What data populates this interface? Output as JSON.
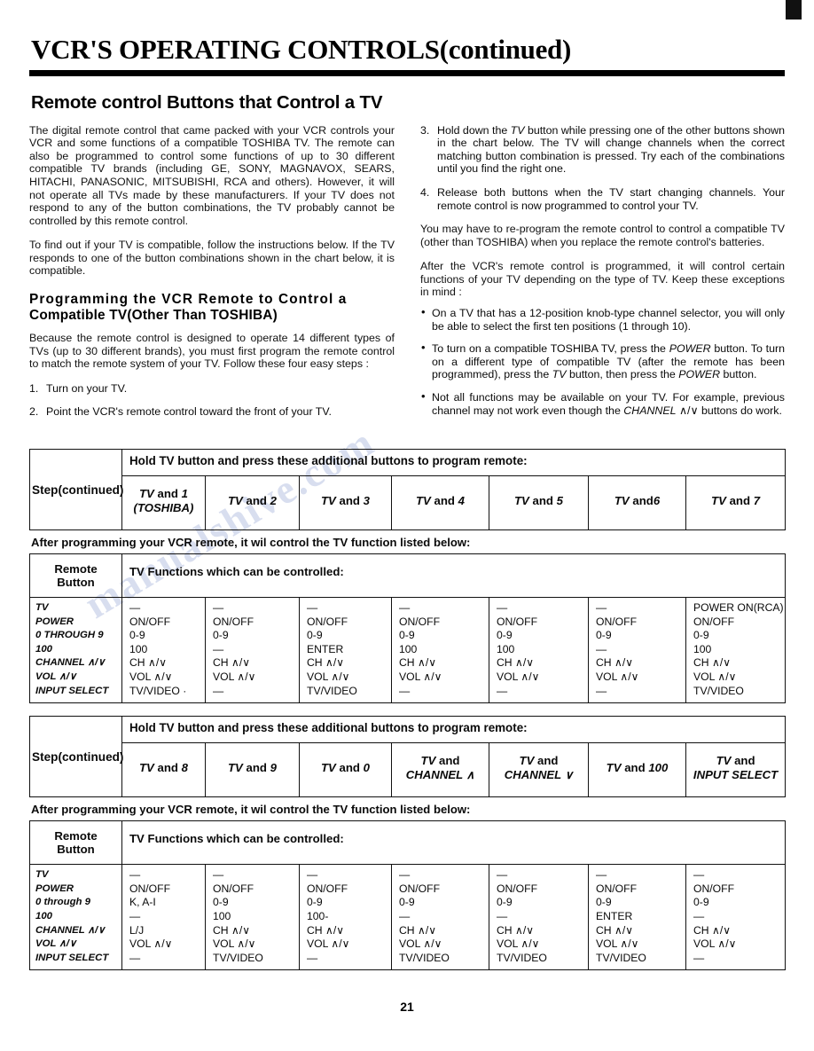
{
  "document": {
    "title": "VCR'S OPERATING CONTROLS(continued)",
    "section_title": "Remote control Buttons that Control a TV",
    "page_number": "21",
    "watermark": "manualshive.com"
  },
  "left_column": {
    "intro_p1": "The digital remote control that came packed with your VCR controls your VCR and some functions of a compatible TOSHIBA TV. The remote can also be programmed to control some functions of up to 30 different compatible TV brands (including GE, SONY, MAGNAVOX, SEARS, HITACHI, PANASONIC, MITSUBISHI, RCA and others). However, it will not operate all TVs made by these manufacturers. If your TV does not respond to any of the button combinations, the TV probably cannot be controlled by this remote control.",
    "intro_p2": "To find out if your TV is compatible, follow the instructions below. If the TV responds to one of the button combinations shown in the chart below, it is compatible.",
    "subhead_line1": "Programming the VCR Remote to Control a",
    "subhead_line2": "Compatible TV(Other Than TOSHIBA)",
    "body_p3": "Because the remote control is designed to operate 14 different types of TVs (up to 30 different brands), you must first program the remote control to match the remote system of your TV. Follow these four easy steps :",
    "steps": [
      {
        "num": "1.",
        "text": "Turn on your TV."
      },
      {
        "num": "2.",
        "text": "Point the VCR's remote control toward the front of your TV."
      }
    ]
  },
  "right_column": {
    "steps": [
      {
        "num": "3.",
        "pre": "Hold down the ",
        "em": "TV",
        "post": " button while pressing one of the other buttons shown in the chart below. The TV will change channels when the correct matching button combination is pressed. Try each of the combinations until you find the right one."
      },
      {
        "num": "4.",
        "pre": "Release both buttons when the TV start changing channels. Your remote control is now programmed to control your TV.",
        "em": "",
        "post": ""
      }
    ],
    "p_reprogram": "You may have to re-program the remote control to control a compatible TV (other than TOSHIBA) when you replace the remote control's batteries.",
    "p_exceptions": "After the VCR's remote control is programmed, it will control certain functions of your TV depending on the type of TV. Keep these exceptions in mind :",
    "bullets": [
      {
        "pre": "On a TV that has a 12-position knob-type channel selector, you will only be able to select the first ten positions (1 through 10).",
        "em": "",
        "post": ""
      },
      {
        "pre": "To turn on a compatible TOSHIBA TV, press the ",
        "em": "POWER",
        "mid": " button. To turn on a different type of compatible TV (after the remote has been programmed), press the ",
        "em2": "TV",
        "mid2": " button, then press the ",
        "em3": "POWER",
        "post": " button."
      },
      {
        "pre": "Not all functions may be available on your TV. For example, previous channel may not work even though the ",
        "em": "CHANNEL",
        "arrows": " ∧/∨ ",
        "post": "buttons do work."
      }
    ]
  },
  "table1": {
    "step_label": "Step(continued)",
    "hold_header": "Hold TV button and press these additional buttons to program remote:",
    "combos": [
      {
        "tv": "TV",
        "and": " and ",
        "key": "1",
        "sub": "(TOSHIBA)"
      },
      {
        "tv": "TV",
        "and": " and ",
        "key": "2",
        "sub": ""
      },
      {
        "tv": "TV",
        "and": " and ",
        "key": "3",
        "sub": ""
      },
      {
        "tv": "TV",
        "and": " and ",
        "key": "4",
        "sub": ""
      },
      {
        "tv": "TV",
        "and": " and ",
        "key": "5",
        "sub": ""
      },
      {
        "tv": "TV",
        "and": " and",
        "key": "6",
        "sub": ""
      },
      {
        "tv": "TV",
        "and": " and ",
        "key": "7",
        "sub": ""
      }
    ],
    "after_note": "After programming your VCR remote, it wil control the TV function listed below:",
    "remote_button_head_l1": "Remote",
    "remote_button_head_l2": "Button",
    "functions_head": "TV Functions which can be controlled:",
    "remote_buttons": [
      "TV",
      "POWER",
      "0 THROUGH 9",
      "100",
      "CHANNEL ∧/∨",
      "VOL ∧/∨",
      "INPUT SELECT"
    ],
    "columns": [
      [
        "—",
        "ON/OFF",
        "0-9",
        "100",
        "CH ∧/∨",
        "VOL ∧/∨",
        "TV/VIDEO ·"
      ],
      [
        "—",
        "ON/OFF",
        "0-9",
        "—",
        "CH ∧/∨",
        "VOL ∧/∨",
        "—"
      ],
      [
        "—",
        "ON/OFF",
        "0-9",
        "ENTER",
        "CH ∧/∨",
        "VOL ∧/∨",
        "TV/VIDEO"
      ],
      [
        "—",
        "ON/OFF",
        "0-9",
        "100",
        "CH ∧/∨",
        "VOL ∧/∨",
        "—"
      ],
      [
        "—",
        "ON/OFF",
        "0-9",
        "100",
        "CH ∧/∨",
        "VOL ∧/∨",
        "—"
      ],
      [
        "—",
        "ON/OFF",
        "0-9",
        "—",
        "CH ∧/∨",
        "VOL ∧/∨",
        "—"
      ],
      [
        "POWER ON(RCA)",
        "ON/OFF",
        "0-9",
        "100",
        "CH ∧/∨",
        "VOL ∧/∨",
        "TV/VIDEO"
      ]
    ]
  },
  "table2": {
    "step_label": "Step(continued)",
    "hold_header": "Hold TV button and press these additional buttons to program remote:",
    "combos": [
      {
        "tv": "TV",
        "and": " and ",
        "key": "8",
        "sub": ""
      },
      {
        "tv": "TV",
        "and": " and ",
        "key": "9",
        "sub": ""
      },
      {
        "tv": "TV",
        "and": " and ",
        "key": "0",
        "sub": ""
      },
      {
        "tv": "TV",
        "and": " and",
        "key": "",
        "sub": "CHANNEL ∧"
      },
      {
        "tv": "TV",
        "and": " and",
        "key": "",
        "sub": "CHANNEL ∨"
      },
      {
        "tv": "TV",
        "and": " and ",
        "key": "100",
        "sub": ""
      },
      {
        "tv": "TV",
        "and": " and",
        "key": "",
        "sub": "INPUT SELECT"
      }
    ],
    "after_note": "After programming your VCR remote, it wil control the TV function listed below:",
    "remote_button_head_l1": "Remote",
    "remote_button_head_l2": "Button",
    "functions_head": "TV Functions which can be controlled:",
    "remote_buttons": [
      "TV",
      "POWER",
      "0 through 9",
      "100",
      "CHANNEL ∧/∨",
      "VOL ∧/∨",
      "INPUT SELECT"
    ],
    "columns": [
      [
        "—",
        "ON/OFF",
        "K, A-I",
        "—",
        "L/J",
        "VOL ∧/∨",
        "—"
      ],
      [
        "—",
        "ON/OFF",
        "0-9",
        "100",
        "CH ∧/∨",
        "VOL ∧/∨",
        "TV/VIDEO"
      ],
      [
        "—",
        "ON/OFF",
        "0-9",
        "100-",
        "CH ∧/∨",
        "VOL ∧/∨",
        "—"
      ],
      [
        "—",
        "ON/OFF",
        "0-9",
        "—",
        "CH ∧/∨",
        "VOL ∧/∨",
        "TV/VIDEO"
      ],
      [
        "—",
        "ON/OFF",
        "0-9",
        "—",
        "CH ∧/∨",
        "VOL ∧/∨",
        "TV/VIDEO"
      ],
      [
        "—",
        "ON/OFF",
        "0-9",
        "ENTER",
        "CH ∧/∨",
        "VOL ∧/∨",
        "TV/VIDEO"
      ],
      [
        "—",
        "ON/OFF",
        "0-9",
        "—",
        "CH ∧/∨",
        "VOL ∧/∨",
        "—"
      ]
    ]
  }
}
